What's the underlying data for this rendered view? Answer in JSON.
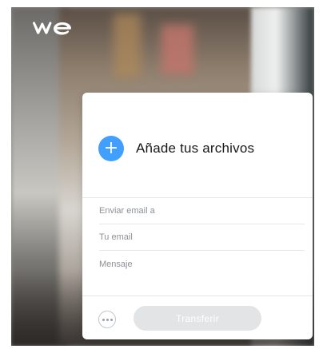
{
  "brand": {
    "logo_icon": "wetransfer-logo-icon",
    "logo_color": "#ffffff"
  },
  "uploader": {
    "add_files_icon": "plus-icon",
    "add_files_label": "Añade tus archivos",
    "accent": "#409fff"
  },
  "form": {
    "email_to_placeholder": "Enviar email a",
    "your_email_placeholder": "Tu email",
    "message_placeholder": "Mensaje"
  },
  "actions": {
    "more_options_icon": "ellipsis-icon",
    "transfer_label": "Transferir",
    "transfer_enabled": false,
    "transfer_bg": "#e2e4e6"
  }
}
